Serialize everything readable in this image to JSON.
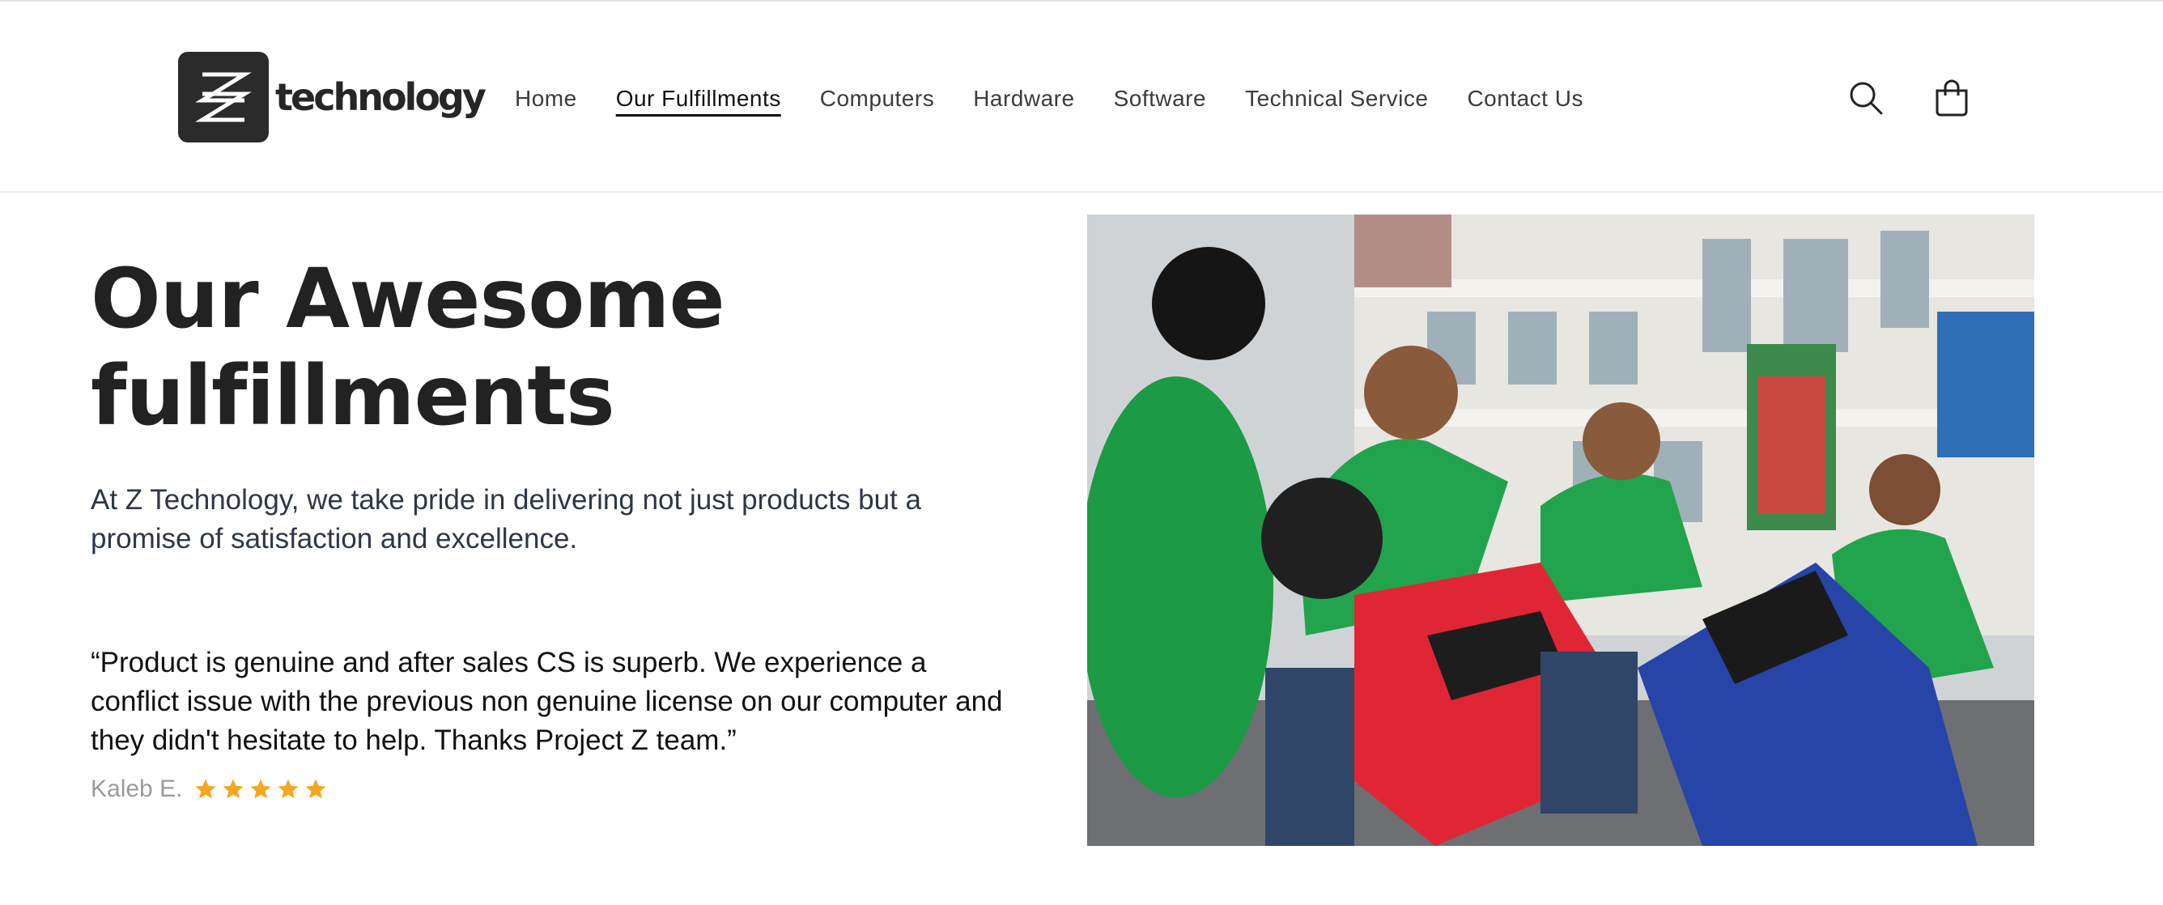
{
  "brand": {
    "name": "technology"
  },
  "nav": {
    "items": [
      {
        "label": "Home"
      },
      {
        "label": "Our Fulfillments",
        "active": true
      },
      {
        "label": "Computers"
      },
      {
        "label": "Hardware"
      },
      {
        "label": "Software"
      },
      {
        "label": "Technical Service"
      },
      {
        "label": "Contact Us"
      }
    ]
  },
  "header_icons": {
    "search": "search-icon",
    "cart": "cart-icon"
  },
  "hero": {
    "title_line1": "Our Awesome",
    "title_line2": "fulfillments",
    "subtitle": "At Z Technology, we take pride in delivering not just products but a promise of satisfaction and excellence."
  },
  "testimonial": {
    "quote": "“Product is genuine and after sales CS is superb. We experience a conflict issue with the previous non genuine license on our computer and they didn't hesitate to help. Thanks Project Z team.”",
    "author": "Kaleb E.",
    "rating": 5
  },
  "colors": {
    "star": "#f5a623",
    "logo_bg": "#2b2b2b",
    "jacket_green": "#1fa84a"
  }
}
